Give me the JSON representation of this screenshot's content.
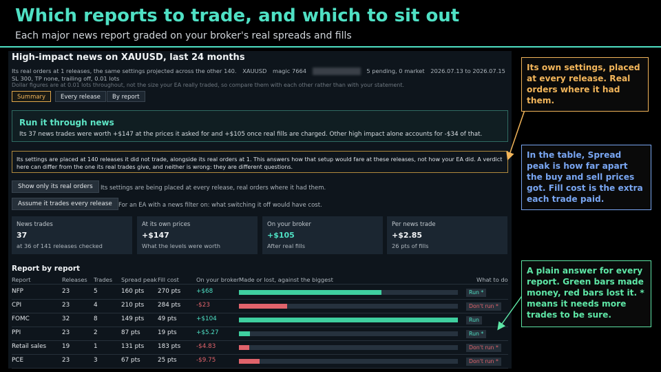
{
  "slide": {
    "title": "Which reports to trade, and which to sit out",
    "subtitle": "Each major news report graded on your broker's real spreads and fills",
    "accent": "#4fe0c4"
  },
  "panel": {
    "title": "High-impact news on XAUUSD, last 24 months",
    "meta": {
      "line1_desc": "Its real orders at 1 releases, the same settings projected across the other 140.",
      "symbol": "XAUUSD",
      "magic": "magic 7664",
      "status": "5 pending, 0 market",
      "date_range": "2026.07.13 to 2026.07.15",
      "line2": "SL 300, TP none, trailing off, 0.01 lots",
      "line3": "Dollar figures are at 0.01 lots throughout, not the size your EA really traded, so compare them with each other rather than with your statement."
    },
    "tabs": [
      "Summary",
      "Every release",
      "By report"
    ],
    "active_tab": "Summary",
    "run": {
      "title": "Run it through news",
      "text": "Its 37 news trades were worth +$147 at the prices it asked for and +$105 once real fills are charged. Other high impact alone accounts for -$34 of that."
    },
    "note": "Its settings are placed at 140 releases it did not trade, alongside its real orders at 1.  This answers how that setup would fare at these releases, not how your EA did. A verdict here can differ from the one its real trades give, and neither is wrong: they are different questions.",
    "buttons": [
      {
        "label": "Show only its real orders",
        "desc": "Its settings are being placed at every release, real orders where it had them."
      },
      {
        "label": "Assume it trades every release",
        "desc": "For an EA with a news filter on: what switching it off would have cost."
      }
    ],
    "cards": [
      {
        "label": "News trades",
        "value": "37",
        "detail": "at 36 of 141 releases checked",
        "positive": false
      },
      {
        "label": "At its own prices",
        "value": "+$147",
        "detail": "What the levels were worth",
        "positive": false
      },
      {
        "label": "On your broker",
        "value": "+$105",
        "detail": "After real fills",
        "positive": true
      },
      {
        "label": "Per news trade",
        "value": "+$2.85",
        "detail": "26 pts of fills",
        "positive": false
      }
    ],
    "table": {
      "title": "Report by report",
      "headers": [
        "Report",
        "Releases",
        "Trades",
        "Spread peak",
        "Fill cost",
        "On your broker",
        "Made or lost, against the biggest",
        "What to do"
      ],
      "rows": [
        {
          "report": "NFP",
          "releases": "23",
          "trades": "5",
          "spread_peak": "160 pts",
          "fill_cost": "270 pts",
          "broker": "+$68",
          "bar_fraction": 0.65,
          "bar_sign": "pos",
          "verdict": "Run *"
        },
        {
          "report": "CPI",
          "releases": "23",
          "trades": "4",
          "spread_peak": "210 pts",
          "fill_cost": "284 pts",
          "broker": "-$23",
          "bar_fraction": 0.22,
          "bar_sign": "neg",
          "verdict": "Don't run *"
        },
        {
          "report": "FOMC",
          "releases": "32",
          "trades": "8",
          "spread_peak": "149 pts",
          "fill_cost": "49 pts",
          "broker": "+$104",
          "bar_fraction": 1.0,
          "bar_sign": "pos",
          "verdict": "Run"
        },
        {
          "report": "PPI",
          "releases": "23",
          "trades": "2",
          "spread_peak": "87 pts",
          "fill_cost": "19 pts",
          "broker": "+$5.27",
          "bar_fraction": 0.05,
          "bar_sign": "pos",
          "verdict": "Run *"
        },
        {
          "report": "Retail sales",
          "releases": "19",
          "trades": "1",
          "spread_peak": "131 pts",
          "fill_cost": "183 pts",
          "broker": "-$4.83",
          "bar_fraction": 0.047,
          "bar_sign": "neg",
          "verdict": "Don't run *"
        },
        {
          "report": "PCE",
          "releases": "23",
          "trades": "3",
          "spread_peak": "67 pts",
          "fill_cost": "25 pts",
          "broker": "-$9.75",
          "bar_fraction": 0.094,
          "bar_sign": "neg",
          "verdict": "Don't run *"
        }
      ],
      "colors": {
        "pos": "#3fcf9f",
        "neg": "#e0636b"
      }
    }
  },
  "callouts": [
    {
      "text": "Its own settings, placed at every release. Real orders where it had them.",
      "color": "#f2b55a"
    },
    {
      "text": "In the table, Spread peak is how far apart the buy and sell prices got. Fill cost is the extra each trade paid.",
      "color": "#79a6f2"
    },
    {
      "text": "A plain answer for every report. Green bars made money, red bars lost it. * means it needs more trades to be sure.",
      "color": "#5ee6a6"
    }
  ]
}
